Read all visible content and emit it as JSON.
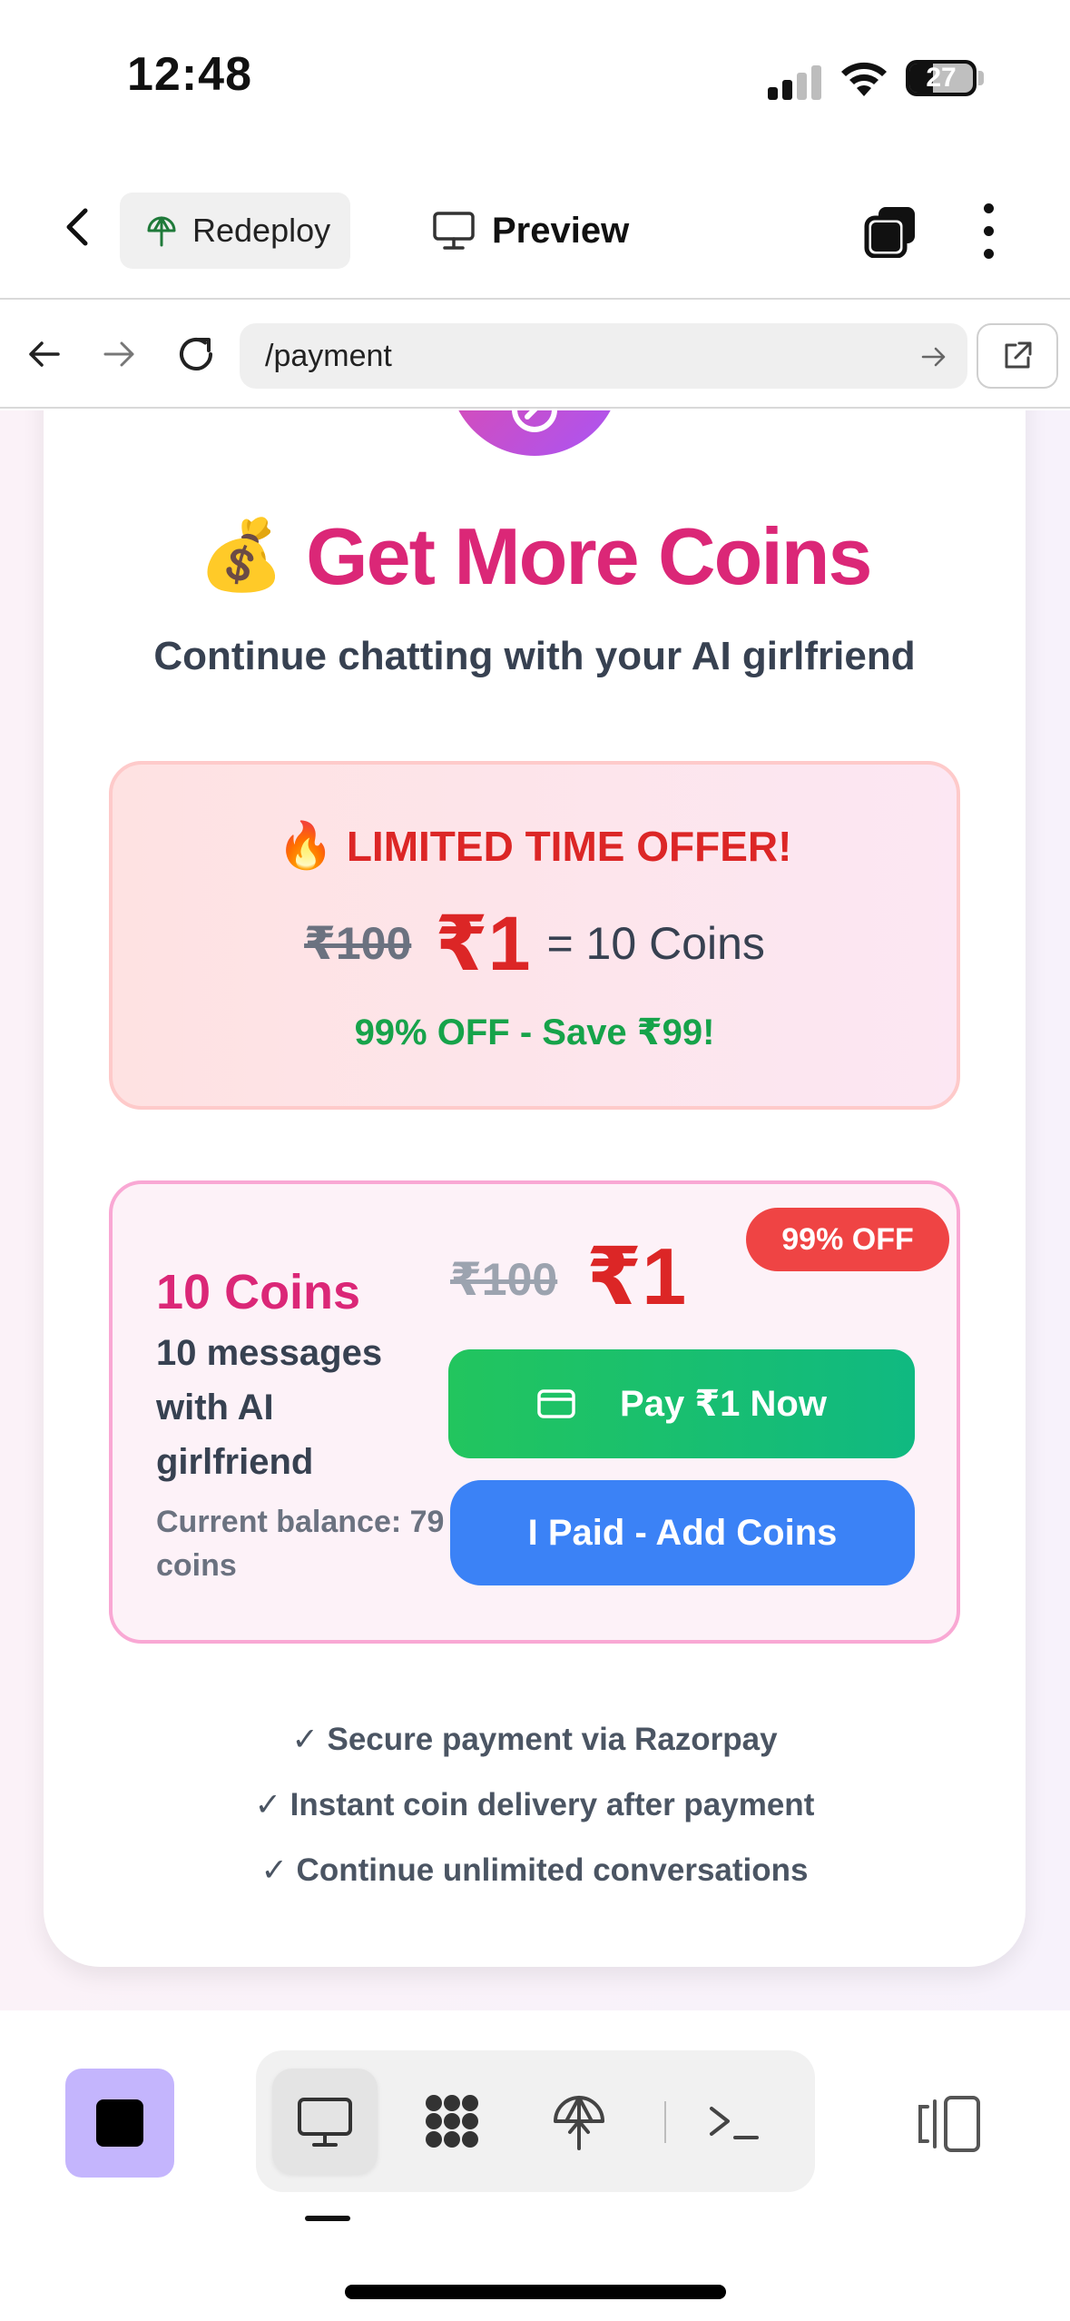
{
  "status_bar": {
    "time": "12:48",
    "battery": "27"
  },
  "toolbar": {
    "redeploy_label": "Redeploy",
    "preview_label": "Preview"
  },
  "browser": {
    "url": "/payment"
  },
  "page": {
    "headline_emoji": "💰",
    "headline": "Get More Coins",
    "subtitle": "Continue chatting with your AI girlfriend",
    "offer": {
      "emoji": "🔥",
      "title": "LIMITED TIME OFFER!",
      "old_price": "₹100",
      "new_price": "₹1",
      "equals": "= 10 Coins",
      "save": "99% OFF - Save ₹99!"
    },
    "plan": {
      "badge": "99% OFF",
      "name": "10 Coins",
      "description": "10 messages with AI girlfriend",
      "balance": "Current balance: 79 coins",
      "old_price": "₹100",
      "new_price": "₹1",
      "pay_button": "Pay ₹1 Now",
      "paid_button": "I Paid - Add Coins"
    },
    "features": [
      "✓ Secure payment via Razorpay",
      "✓ Instant coin delivery after payment",
      "✓ Continue unlimited conversations"
    ]
  },
  "bottom_bar": {
    "tools": [
      "monitor-icon",
      "apps-grid-icon",
      "deploy-icon",
      "terminal-icon"
    ],
    "active_tool": "monitor-icon"
  },
  "colors": {
    "accent_pink": "#db2777",
    "offer_red": "#dc2626",
    "success_green": "#16a34a",
    "pay_button_green": "#22c55e",
    "paid_button_blue": "#3b82f6",
    "stop_button_purple": "#c4b5fd"
  }
}
